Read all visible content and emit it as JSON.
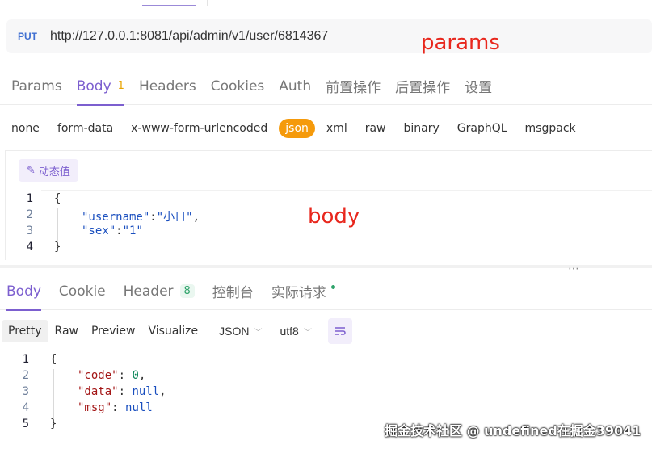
{
  "request": {
    "method": "PUT",
    "url": "http://127.0.0.1:8081/api/admin/v1/user/6814367"
  },
  "annotations": {
    "params": "params",
    "body": "body"
  },
  "request_tabs": [
    {
      "label": "Params"
    },
    {
      "label": "Body",
      "badge": "1"
    },
    {
      "label": "Headers"
    },
    {
      "label": "Cookies"
    },
    {
      "label": "Auth"
    },
    {
      "label": "前置操作"
    },
    {
      "label": "后置操作"
    },
    {
      "label": "设置"
    }
  ],
  "body_types": [
    "none",
    "form-data",
    "x-www-form-urlencoded",
    "json",
    "xml",
    "raw",
    "binary",
    "GraphQL",
    "msgpack"
  ],
  "body_type_selected": "json",
  "dynamic_value_label": "动态值",
  "request_body": {
    "line_numbers": [
      "1",
      "2",
      "3",
      "4"
    ],
    "open": "{",
    "k1": "\"username\"",
    "v1": "\"小日\"",
    "k2": "\"sex\"",
    "v2": "\"1\"",
    "close": "}"
  },
  "response_tabs": [
    {
      "label": "Body"
    },
    {
      "label": "Cookie"
    },
    {
      "label": "Header",
      "badge": "8"
    },
    {
      "label": "控制台"
    },
    {
      "label": "实际请求"
    }
  ],
  "view_modes": [
    "Pretty",
    "Raw",
    "Preview",
    "Visualize"
  ],
  "format_select": "JSON",
  "encoding_select": "utf8",
  "response_body": {
    "line_numbers": [
      "1",
      "2",
      "3",
      "4",
      "5"
    ],
    "open": "{",
    "k1": "\"code\"",
    "v1": "0",
    "k2": "\"data\"",
    "v2": "null",
    "k3": "\"msg\"",
    "v3": "null",
    "close": "}"
  },
  "watermark": "掘金技术社区 @ undefined在掘金39041",
  "colors": {
    "accent": "#7c5fcf",
    "json_chip": "#f59a0b",
    "method": "#3f6fd1",
    "annotation": "#e8271d",
    "success": "#2ea36a"
  }
}
